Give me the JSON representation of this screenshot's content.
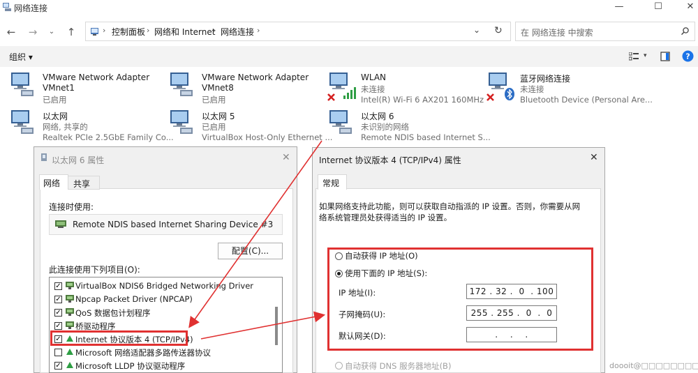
{
  "window": {
    "title": "网络连接",
    "controls": [
      "—",
      "☐",
      "✕"
    ]
  },
  "address_bar": {
    "breadcrumbs": [
      "控制面板",
      "网络和 Internet",
      "网络连接"
    ],
    "search_placeholder": "在 网络连接 中搜索"
  },
  "toolbar": {
    "organize_label": "组织 ▾"
  },
  "connections": [
    {
      "name": "VMware Network Adapter",
      "name2": "VMnet1",
      "status": "已启用",
      "device": "",
      "icon": "ethernet-adapter-icon",
      "error": false
    },
    {
      "name": "VMware Network Adapter",
      "name2": "VMnet8",
      "status": "已启用",
      "device": "",
      "icon": "ethernet-adapter-icon",
      "error": false
    },
    {
      "name": "WLAN",
      "name2": "",
      "status": "未连接",
      "device": "Intel(R) Wi-Fi 6 AX201 160MHz",
      "icon": "wifi-adapter-icon",
      "error": true
    },
    {
      "name": "蓝牙网络连接",
      "name2": "",
      "status": "未连接",
      "device": "Bluetooth Device (Personal Are...",
      "icon": "bluetooth-adapter-icon",
      "error": true
    },
    {
      "name": "以太网",
      "name2": "",
      "status": "网络, 共享的",
      "device": "Realtek PCIe 2.5GbE Family Co...",
      "icon": "ethernet-adapter-icon",
      "error": false
    },
    {
      "name": "以太网 5",
      "name2": "",
      "status": "已启用",
      "device": "VirtualBox Host-Only Ethernet ...",
      "icon": "ethernet-adapter-icon",
      "error": false
    },
    {
      "name": "以太网 6",
      "name2": "",
      "status": "未识别的网络",
      "device": "Remote NDIS based Internet S...",
      "icon": "ethernet-adapter-icon",
      "error": false
    }
  ],
  "properties_dialog": {
    "title": "以太网 6 属性",
    "tabs": [
      "网络",
      "共享"
    ],
    "connect_using_label": "连接时使用:",
    "adapter_name": "Remote NDIS based Internet Sharing Device #3",
    "configure_button": "配置(C)...",
    "items_label": "此连接使用下列项目(O):",
    "items": [
      {
        "label": "VirtualBox NDIS6 Bridged Networking Driver",
        "checked": true,
        "icon": "network-service-icon"
      },
      {
        "label": "Npcap Packet Driver (NPCAP)",
        "checked": true,
        "icon": "network-service-icon"
      },
      {
        "label": "QoS 数据包计划程序",
        "checked": true,
        "icon": "network-service-icon"
      },
      {
        "label": "桥驱动程序",
        "checked": true,
        "icon": "network-service-icon"
      },
      {
        "label": "Internet 协议版本 4 (TCP/IPv4)",
        "checked": true,
        "icon": "protocol-icon"
      },
      {
        "label": "Microsoft 网络适配器多路传送器协议",
        "checked": false,
        "icon": "protocol-icon"
      },
      {
        "label": "Microsoft LLDP 协议驱动程序",
        "checked": true,
        "icon": "protocol-icon"
      }
    ]
  },
  "ipv4_dialog": {
    "title": "Internet 协议版本 4 (TCP/IPv4) 属性",
    "tab": "常规",
    "description_line1": "如果网络支持此功能，则可以获取自动指派的 IP 设置。否则，你需要从网",
    "description_line2": "络系统管理员处获得适当的 IP 设置。",
    "auto_ip_label": "自动获得 IP 地址(O)",
    "manual_ip_label": "使用下面的 IP 地址(S):",
    "ip_label": "IP 地址(I):",
    "ip_value": "172 . 32 .  0  . 100",
    "mask_label": "子网掩码(U):",
    "mask_value": "255 . 255 .  0  .  0",
    "gateway_label": "默认网关(D):",
    "gateway_value": " .    .    . ",
    "auto_dns_label": "自动获得 DNS 服务器地址(B)"
  },
  "watermark": "doooit@□□□□□□□□",
  "colors": {
    "accent": "#005fb8",
    "highlight": "#e03131",
    "toolbar_bg": "#f3f3f3",
    "dialog_bg": "#f0f0f0"
  }
}
